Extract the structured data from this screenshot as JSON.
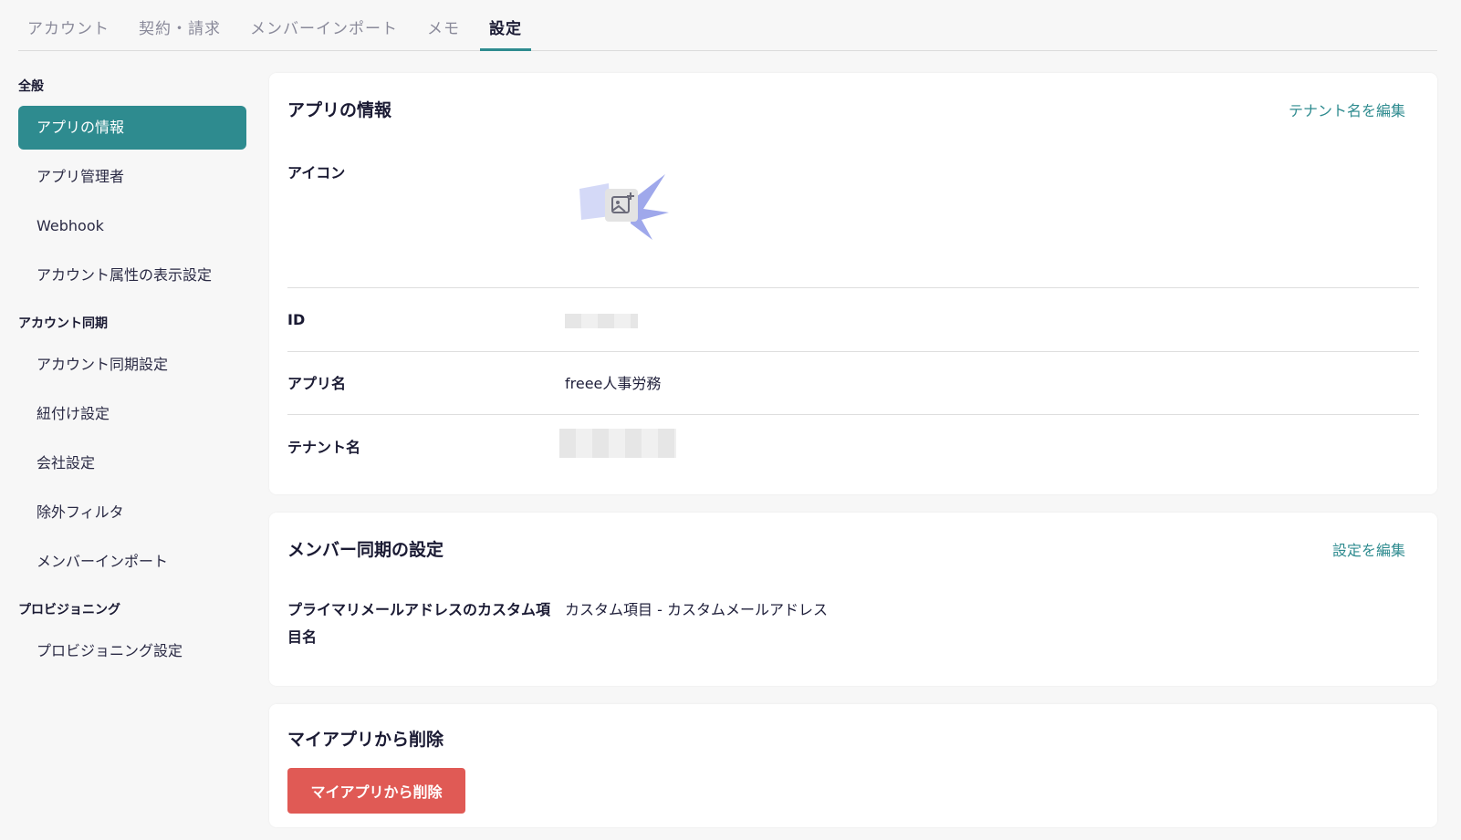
{
  "tabs": [
    "アカウント",
    "契約・請求",
    "メンバーインポート",
    "メモ",
    "設定"
  ],
  "sidebar": {
    "general": {
      "heading": "全般",
      "items": [
        "アプリの情報",
        "アプリ管理者",
        "Webhook",
        "アカウント属性の表示設定"
      ]
    },
    "sync": {
      "heading": "アカウント同期",
      "items": [
        "アカウント同期設定",
        "紐付け設定",
        "会社設定",
        "除外フィルタ",
        "メンバーインポート"
      ]
    },
    "provisioning": {
      "heading": "プロビジョニング",
      "items": [
        "プロビジョニング設定"
      ]
    }
  },
  "app_info": {
    "title": "アプリの情報",
    "edit_link": "テナント名を編集",
    "icon_label": "アイコン",
    "id_label": "ID",
    "app_name_label": "アプリ名",
    "app_name_value": "freee人事労務",
    "tenant_label": "テナント名"
  },
  "member_sync": {
    "title": "メンバー同期の設定",
    "edit_link": "設定を編集",
    "primary_email_label": "プライマリメールアドレスのカスタム項目名",
    "primary_email_value": "カスタム項目 - カスタムメールアドレス"
  },
  "delete_section": {
    "title": "マイアプリから削除",
    "button": "マイアプリから削除"
  },
  "colors": {
    "accent": "#2e8b8f",
    "danger": "#e05a55"
  }
}
